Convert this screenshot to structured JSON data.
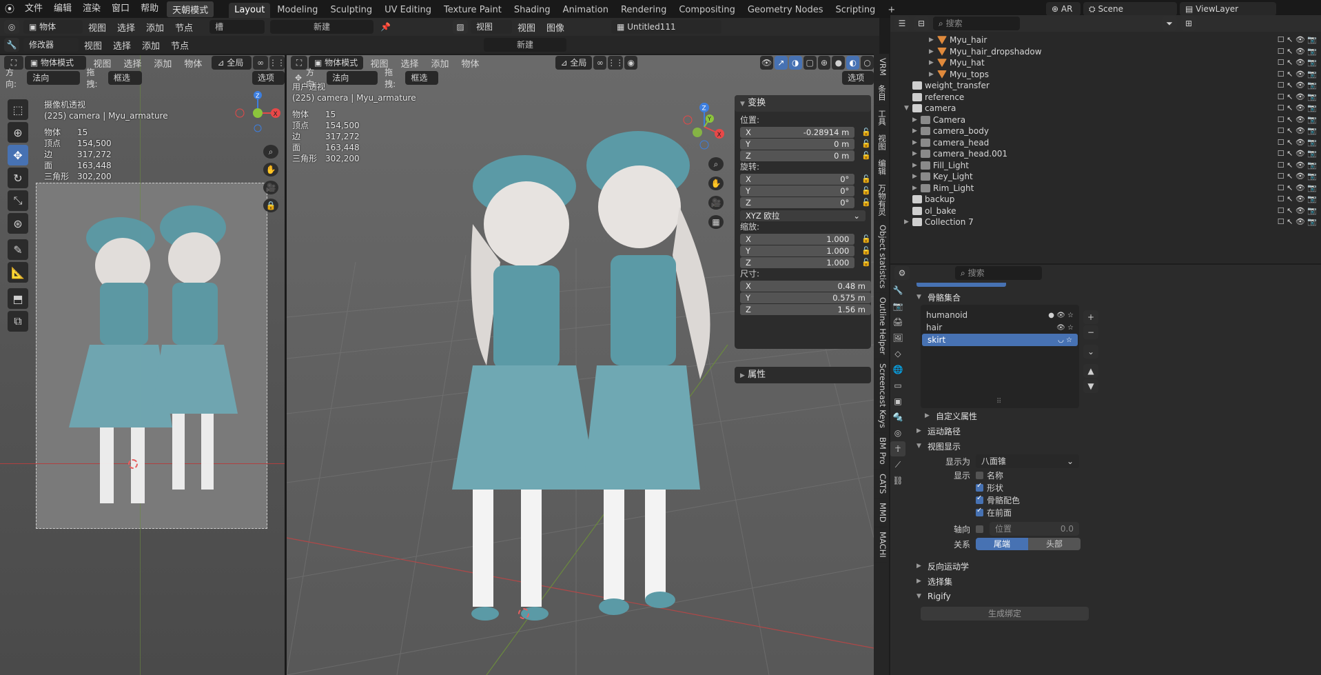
{
  "topbar": {
    "menus": [
      "文件",
      "编辑",
      "渲染",
      "窗口",
      "帮助"
    ],
    "mode_badge": "天朝模式",
    "workspaces": [
      "Layout",
      "Modeling",
      "Sculpting",
      "UV Editing",
      "Texture Paint",
      "Shading",
      "Animation",
      "Rendering",
      "Compositing",
      "Geometry Nodes",
      "Scripting"
    ],
    "active_workspace": "Layout",
    "add_tab": "+",
    "ar_label": "AR",
    "scene_name": "Scene",
    "viewlayer_name": "ViewLayer"
  },
  "header2": {
    "left_object": "物体",
    "left_menus": [
      "视图",
      "选择",
      "添加",
      "节点"
    ],
    "slot_label": "槽",
    "new_label": "新建",
    "image_menus": [
      "视图",
      "图像"
    ],
    "image_view_dd": "视图",
    "image_name": "Untitled111",
    "modifier_dd": "修改器",
    "row3_menus": [
      "视图",
      "选择",
      "添加",
      "节点"
    ],
    "row3_new": "新建"
  },
  "left_viewport": {
    "mode": "物体模式",
    "menus": [
      "视图",
      "选择",
      "添加",
      "物体"
    ],
    "transform_orient": "全局",
    "orient_label": "方向:",
    "orient_value": "法向",
    "drag_label": "拖拽:",
    "drag_value": "框选",
    "options": "选项",
    "view_name": "摄像机透视",
    "view_obj": "(225) camera | Myu_armature",
    "stats": [
      {
        "label": "物体",
        "value": "15"
      },
      {
        "label": "顶点",
        "value": "154,500"
      },
      {
        "label": "边",
        "value": "317,272"
      },
      {
        "label": "面",
        "value": "163,448"
      },
      {
        "label": "三角形",
        "value": "302,200"
      }
    ]
  },
  "main_viewport": {
    "mode": "物体模式",
    "menus": [
      "视图",
      "选择",
      "添加",
      "物体"
    ],
    "transform_orient": "全局",
    "orient_label": "方向:",
    "orient_value": "法向",
    "drag_label": "拖拽:",
    "drag_value": "框选",
    "options": "选项",
    "view_name": "用户透视",
    "view_obj": "(225) camera | Myu_armature",
    "stats": [
      {
        "label": "物体",
        "value": "15"
      },
      {
        "label": "顶点",
        "value": "154,500"
      },
      {
        "label": "边",
        "value": "317,272"
      },
      {
        "label": "面",
        "value": "163,448"
      },
      {
        "label": "三角形",
        "value": "302,200"
      }
    ]
  },
  "npanel": {
    "title": "变换",
    "location_label": "位置:",
    "location": [
      {
        "axis": "X",
        "value": "-0.28914 m"
      },
      {
        "axis": "Y",
        "value": "0 m"
      },
      {
        "axis": "Z",
        "value": "0 m"
      }
    ],
    "rotation_label": "旋转:",
    "rotation": [
      {
        "axis": "X",
        "value": "0°"
      },
      {
        "axis": "Y",
        "value": "0°"
      },
      {
        "axis": "Z",
        "value": "0°"
      }
    ],
    "rotation_mode": "XYZ 欧拉",
    "scale_label": "缩放:",
    "scale": [
      {
        "axis": "X",
        "value": "1.000"
      },
      {
        "axis": "Y",
        "value": "1.000"
      },
      {
        "axis": "Z",
        "value": "1.000"
      }
    ],
    "dimensions_label": "尺寸:",
    "dimensions": [
      {
        "axis": "X",
        "value": "0.48 m"
      },
      {
        "axis": "Y",
        "value": "0.575 m"
      },
      {
        "axis": "Z",
        "value": "1.56 m"
      }
    ],
    "properties_title": "属性"
  },
  "side_tabs": [
    "VRM",
    "条目",
    "工具",
    "视图",
    "编辑",
    "万物有灵",
    "Object statistics",
    "Outline Helper",
    "Screencast Keys",
    "BM Pro",
    "CATS",
    "MMD",
    "MACHI"
  ],
  "outliner": {
    "search_placeholder": "搜索",
    "rows": [
      {
        "name": "Myu_hair",
        "indent": 4,
        "icon": "mesh",
        "expand": true
      },
      {
        "name": "Myu_hair_dropshadow",
        "indent": 4,
        "icon": "mesh",
        "expand": true
      },
      {
        "name": "Myu_hat",
        "indent": 4,
        "icon": "mesh",
        "expand": true
      },
      {
        "name": "Myu_tops",
        "indent": 4,
        "icon": "mesh",
        "expand": true
      },
      {
        "name": "weight_transfer",
        "indent": 1,
        "icon": "collection",
        "expand": false
      },
      {
        "name": "reference",
        "indent": 1,
        "icon": "collection",
        "expand": false
      },
      {
        "name": "camera",
        "indent": 1,
        "icon": "collection",
        "expand": true,
        "open": true
      },
      {
        "name": "Camera",
        "indent": 2,
        "icon": "camera",
        "expand": true
      },
      {
        "name": "camera_body",
        "indent": 2,
        "icon": "camera",
        "expand": true
      },
      {
        "name": "camera_head",
        "indent": 2,
        "icon": "camera",
        "expand": true
      },
      {
        "name": "camera_head.001",
        "indent": 2,
        "icon": "camera",
        "expand": true
      },
      {
        "name": "Fill_Light",
        "indent": 2,
        "icon": "light",
        "expand": true
      },
      {
        "name": "Key_Light",
        "indent": 2,
        "icon": "light",
        "expand": true
      },
      {
        "name": "Rim_Light",
        "indent": 2,
        "icon": "light",
        "expand": true
      },
      {
        "name": "backup",
        "indent": 1,
        "icon": "collection",
        "expand": false
      },
      {
        "name": "ol_bake",
        "indent": 1,
        "icon": "collection",
        "expand": false
      },
      {
        "name": "Collection 7",
        "indent": 1,
        "icon": "collection",
        "expand": true
      }
    ]
  },
  "properties": {
    "search_placeholder": "搜索",
    "bone_collections_title": "骨骼集合",
    "bone_collections": [
      {
        "name": "humanoid",
        "active": false
      },
      {
        "name": "hair",
        "active": false
      },
      {
        "name": "skirt",
        "active": true
      }
    ],
    "custom_props": "自定义属性",
    "motion_paths": "运动路径",
    "viewport_display": "视图显示",
    "display_as_label": "显示为",
    "display_as_value": "八面锥",
    "show_label": "显示",
    "show_name": "名称",
    "show_shape": "形状",
    "show_bone_colors": "骨骼配色",
    "show_in_front": "在前面",
    "axes_label": "轴向",
    "axes_position_label": "位置",
    "axes_position_value": "0.0",
    "relations_label": "关系",
    "relation_tail": "尾端",
    "relation_head": "头部",
    "inverse_kinematics": "反向运动学",
    "selection_sets": "选择集",
    "rigify": "Rigify",
    "generate_rig": "生成绑定"
  },
  "colors": {
    "accent": "#4772b3",
    "x_axis": "#e84848",
    "y_axis": "#8cc53c",
    "z_axis": "#3d7fe0"
  }
}
